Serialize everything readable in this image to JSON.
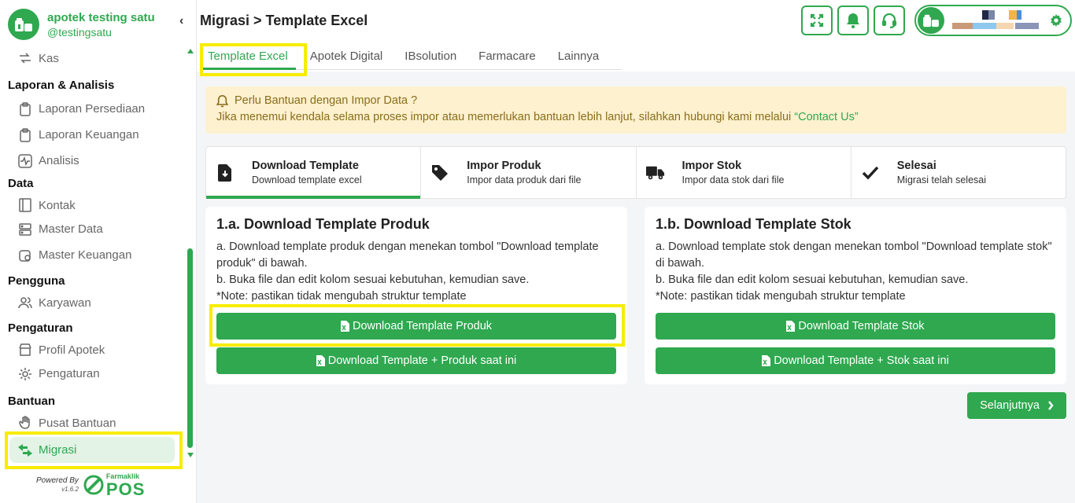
{
  "brand": {
    "name": "apotek testing satu",
    "handle": "@testingsatu"
  },
  "sidebar": {
    "top_item": "Kas",
    "sections": [
      {
        "title": "Laporan & Analisis",
        "items": [
          "Laporan Persediaan",
          "Laporan Keuangan",
          "Analisis"
        ]
      },
      {
        "title": "Data",
        "items": [
          "Kontak",
          "Master Data",
          "Master Keuangan"
        ]
      },
      {
        "title": "Pengguna",
        "items": [
          "Karyawan"
        ]
      },
      {
        "title": "Pengaturan",
        "items": [
          "Profil Apotek",
          "Pengaturan"
        ]
      },
      {
        "title": "Bantuan",
        "items": [
          "Pusat Bantuan",
          "Migrasi"
        ]
      }
    ],
    "active_item": "Migrasi"
  },
  "powered": {
    "label": "Powered By",
    "version": "v1.6.2",
    "brand_small": "Farmaklik",
    "brand_big": "POS"
  },
  "header": {
    "title": "Migrasi > Template Excel"
  },
  "tabs": [
    "Template Excel",
    "Apotek Digital",
    "IBsolution",
    "Farmacare",
    "Lainnya"
  ],
  "alert": {
    "title": "Perlu Bantuan dengan Impor Data ?",
    "message": "Jika menemui kendala selama proses impor atau memerlukan bantuan lebih lanjut, silahkan hubungi kami melalui ",
    "link": "“Contact Us”"
  },
  "steps": [
    {
      "title": "Download Template",
      "desc": "Download template excel",
      "icon": "download-file-icon"
    },
    {
      "title": "Impor Produk",
      "desc": "Impor data produk dari file",
      "icon": "tag-icon"
    },
    {
      "title": "Impor Stok",
      "desc": "Impor data stok dari file",
      "icon": "truck-icon"
    },
    {
      "title": "Selesai",
      "desc": "Migrasi telah selesai",
      "icon": "check-icon"
    }
  ],
  "cards": {
    "produk": {
      "title": "1.a. Download Template Produk",
      "line_a": "a. Download template produk dengan menekan tombol \"Download template produk\" di bawah.",
      "line_b": "b. Buka file dan edit kolom sesuai kebutuhan, kemudian save.",
      "note": "*Note: pastikan tidak mengubah struktur template",
      "btn1": "Download Template Produk",
      "btn2": "Download Template + Produk saat ini"
    },
    "stok": {
      "title": "1.b. Download Template Stok",
      "line_a": "a. Download template stok dengan menekan tombol \"Download template stok\" di bawah.",
      "line_b": "b. Buka file dan edit kolom sesuai kebutuhan, kemudian save.",
      "note": "*Note: pastikan tidak mengubah struktur template",
      "btn1": "Download Template Stok",
      "btn2": "Download Template + Stok saat ini"
    }
  },
  "next_button": "Selanjutnya",
  "colors": {
    "accent": "#2fa84f",
    "alert_bg": "#fdf1cf",
    "highlight": "#f7ec00"
  }
}
